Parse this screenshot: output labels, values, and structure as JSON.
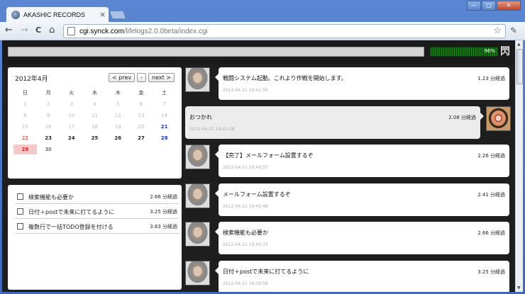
{
  "browser": {
    "tab_title": "AKASHIC RECORDS",
    "tab_close": "×",
    "url_host": "cgi.synck.com",
    "url_path": "/lifelogs2.0.0beta/index.cgi",
    "back_glyph": "←",
    "forward_glyph": "→",
    "reload_glyph": "C",
    "home_glyph": "⌂",
    "star_glyph": "☆",
    "wrench_glyph": "✎",
    "min_glyph": "—",
    "max_glyph": "□",
    "close_glyph": "✕"
  },
  "topbar": {
    "input_value": "",
    "meter_value": "96%",
    "meter_fraction": 0.96,
    "logo_glyph": "閃"
  },
  "calendar": {
    "title": "2012年4月",
    "prev_label": "< prev",
    "mid_label": "-",
    "next_label": "next >",
    "weekdays": [
      "日",
      "月",
      "火",
      "水",
      "木",
      "金",
      "土"
    ],
    "weeks": [
      [
        "1",
        "2",
        "3",
        "4",
        "5",
        "6",
        "7"
      ],
      [
        "8",
        "9",
        "10",
        "11",
        "12",
        "13",
        "14"
      ],
      [
        "15",
        "16",
        "17",
        "18",
        "19",
        "20",
        "21"
      ],
      [
        "22",
        "23",
        "24",
        "25",
        "26",
        "27",
        "28"
      ],
      [
        "29",
        "30",
        "",
        "",
        "",
        "",
        ""
      ]
    ]
  },
  "todos": [
    {
      "text": "検索機能も必要か",
      "ago": "2.66 分経過"
    },
    {
      "text": "日付＋postで未来に打てるように",
      "ago": "3.25 分経過"
    },
    {
      "text": "複数行で一括TODO登録を付ける",
      "ago": "3.63 分経過"
    }
  ],
  "messages": [
    {
      "side": "me",
      "text": "戦闘システム起動。これより作戦を開始します。",
      "ts": "2012-04-21 19:41:59",
      "ago": "1.23 分経過"
    },
    {
      "side": "them",
      "text": "おつかれ",
      "ts": "2012-04-21 19:41:08",
      "ago": "2.08 分経過"
    },
    {
      "side": "me",
      "text": "【完了】メールフォーム設置するぞ",
      "ts": "2012-04-21 19:40:57",
      "ago": "2.26 分経過"
    },
    {
      "side": "me",
      "text": "メールフォーム設置するぞ",
      "ts": "2012-04-21 19:40:48",
      "ago": "2.41 分経過"
    },
    {
      "side": "me",
      "text": "検索機能も必要か",
      "ts": "2012-04-21 19:40:33",
      "ago": "2.66 分経過"
    },
    {
      "side": "me",
      "text": "日付＋postで未来に打てるように",
      "ts": "2012-04-21 19:39:58",
      "ago": "3.25 分経過"
    }
  ]
}
